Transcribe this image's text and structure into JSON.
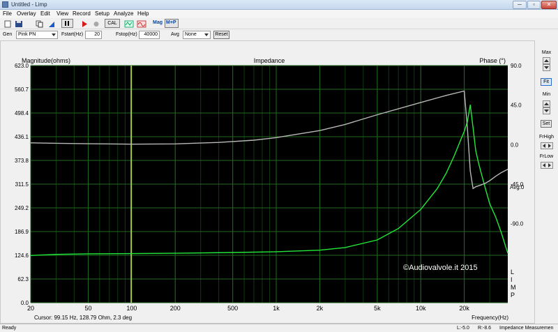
{
  "window": {
    "title": "Untitled - Limp",
    "min_label": "─",
    "max_label": "▫",
    "close_label": "✕"
  },
  "menu": {
    "items": [
      "File",
      "Overlay",
      "Edit",
      "View",
      "Record",
      "Setup",
      "Analyze",
      "Help"
    ]
  },
  "toolbar": {
    "cal_label": "CAL",
    "mag_label": "Mag",
    "mp_label": "M+P"
  },
  "gen": {
    "label": "Gen",
    "signal": "Pink PN",
    "fstart_label": "Fstart(Hz)",
    "fstart_value": "20",
    "fstop_label": "Fstop(Hz)",
    "fstop_value": "40000",
    "avg_label": "Avg",
    "avg_value": "None",
    "reset_label": "Reset"
  },
  "plot": {
    "title": "Impedance",
    "left_axis_label": "Magnitude(ohms)",
    "right_axis_label": "Phase (°)",
    "x_axis_label": "Frequency(Hz)",
    "avg_text": "Avg:0",
    "cursor_text": "Cursor: 99.15 Hz, 128.79 Ohm, 2.3 deg",
    "copyright": "©Audiovalvole.it 2015",
    "watermark_letters": [
      "L",
      "I",
      "M",
      "P"
    ],
    "colors": {
      "magnitude": "#22e83a",
      "phase": "#b8b8b8",
      "cursor": "#c8e65a",
      "grid_major": "#1f6a1f",
      "grid_minor": "#0f3a0f"
    }
  },
  "chart_data": {
    "type": "line",
    "title": "Impedance",
    "xlabel": "Frequency(Hz)",
    "ylabel": "Magnitude(ohms)",
    "y2label": "Phase (°)",
    "xscale": "log",
    "xlim": [
      20,
      40000
    ],
    "ylim": [
      0,
      623
    ],
    "y2lim": [
      -180,
      90
    ],
    "x_ticks": [
      "20",
      "50",
      "100",
      "200",
      "500",
      "1k",
      "2k",
      "5k",
      "10k",
      "20k"
    ],
    "y_ticks": [
      "623.0",
      "560.7",
      "498.4",
      "436.1",
      "373.8",
      "311.5",
      "249.2",
      "186.9",
      "124.6",
      "62.3",
      "0.0"
    ],
    "y2_ticks": [
      "90.0",
      "45.0",
      "0.0",
      "-45.0",
      "-90.0"
    ],
    "grid": true,
    "cursor": {
      "x": 99.15,
      "y": 128.79,
      "phase": 2.3
    },
    "series": [
      {
        "axis": "left",
        "color": "#22e83a",
        "x": [
          20,
          30,
          50,
          100,
          200,
          500,
          1000,
          2000,
          3000,
          5000,
          7000,
          10000,
          13000,
          15000,
          17000,
          19000,
          20000,
          21000,
          22000,
          23000,
          24000,
          25000,
          26000,
          28000,
          30000,
          33000,
          36000,
          40000
        ],
        "y": [
          124.0,
          127.0,
          128.5,
          129.0,
          130.0,
          132.0,
          134.0,
          138.0,
          145.0,
          165.0,
          195.0,
          245.0,
          300.0,
          340.0,
          385.0,
          430.0,
          450.0,
          475.0,
          520.0,
          460.0,
          400.0,
          370.0,
          345.0,
          300.0,
          260.0,
          225.0,
          185.0,
          130.0
        ]
      },
      {
        "axis": "right",
        "color": "#b8b8b8",
        "x": [
          20,
          30,
          50,
          100,
          200,
          400,
          700,
          1000,
          2000,
          3000,
          5000,
          10000,
          15000,
          20000,
          21000,
          22000,
          23000,
          24000,
          26000,
          28000,
          30000,
          33000,
          36000,
          40000
        ],
        "y": [
          2.0,
          1.5,
          1.0,
          0.5,
          0.8,
          2.5,
          5.0,
          8.0,
          16.0,
          23.0,
          34.0,
          48.0,
          56.0,
          61.0,
          20.0,
          -30.0,
          -50.0,
          -48.0,
          -46.0,
          -44.0,
          -41.0,
          -36.0,
          -32.0,
          -28.0
        ]
      }
    ]
  },
  "sidebar": {
    "max_label": "Max",
    "fit_label": "Fit",
    "min_label": "Min",
    "set_label": "Set",
    "frhigh_label": "FrHigh",
    "frlow_label": "FrLow"
  },
  "status": {
    "ready": "Ready",
    "level_left": "L:-5.0",
    "level_right": "R:-8.6",
    "mode": "Impedance Measuremen"
  }
}
